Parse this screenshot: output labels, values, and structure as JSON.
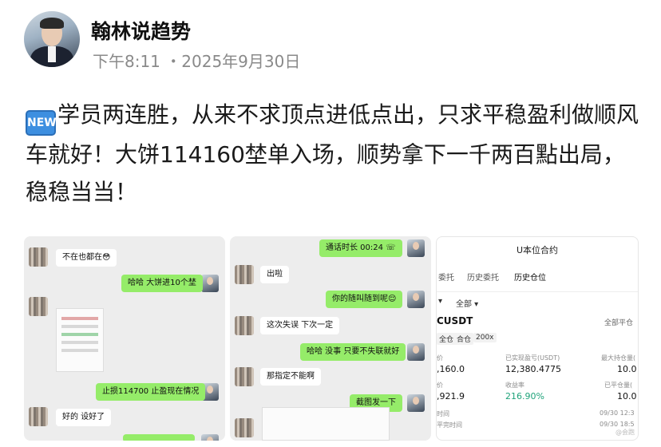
{
  "header": {
    "author": "翰林说趋势",
    "meta": "下午8:11 ・2025年9月30日"
  },
  "post": {
    "badge": "NEW",
    "text": "学员两连胜，从来不求顶点进低点出，只求平稳盈利做顺风车就好！大饼114160埜单入场，顺势拿下一千两百點出局，稳稳当当！"
  },
  "chat1": {
    "messages": [
      {
        "side": "in",
        "text": "不在也都在😳"
      },
      {
        "side": "out",
        "text": "哈哈 大饼进10个埜"
      },
      {
        "side": "out",
        "text": "止损114700 止盈现在情况"
      },
      {
        "side": "in",
        "text": "好的 设好了"
      }
    ]
  },
  "chat2": {
    "messages": [
      {
        "side": "out",
        "text": "通话时长 00:24 ☏"
      },
      {
        "side": "in",
        "text": "出啦"
      },
      {
        "side": "out",
        "text": "你的随叫随到呢😌"
      },
      {
        "side": "in",
        "text": "这次失误 下次一定"
      },
      {
        "side": "out",
        "text": "哈哈 没事 只要不失联就好"
      },
      {
        "side": "in",
        "text": "那指定不能啊"
      },
      {
        "side": "out",
        "text": "截图发一下"
      }
    ]
  },
  "trading": {
    "title": "U本位合约",
    "tabs": [
      "委托",
      "历史委托",
      "历史仓位"
    ],
    "active_tab": "历史仓位",
    "filter_all": "全部 ▾",
    "filter_prefix": "▾",
    "pair": "CUSDT",
    "close_all": "全部平仓",
    "tags": [
      "全仓",
      "合仓",
      "200x"
    ],
    "labels": {
      "open_price": "价",
      "realized_pnl": "已实现盈亏(USDT)",
      "max_position": "最大持仓量(",
      "close_price": "价",
      "roi": "收益率",
      "closed_qty": "已平仓量(",
      "open_time": "时间",
      "close_time": "平完时间"
    },
    "values": {
      "open_price": ",160.0",
      "realized_pnl": "12,380.4775",
      "max_position": "10.0",
      "close_price": ",921.9",
      "roi": "216.90%",
      "closed_qty": "10.0",
      "open_time": "09/30 12:3",
      "close_time": "09/30 18:5"
    },
    "watermark": "@会跑"
  },
  "colors": {
    "wechat_green": "#95ec69",
    "profit_green": "#1fa37a",
    "new_badge": "#3d8fe0"
  }
}
